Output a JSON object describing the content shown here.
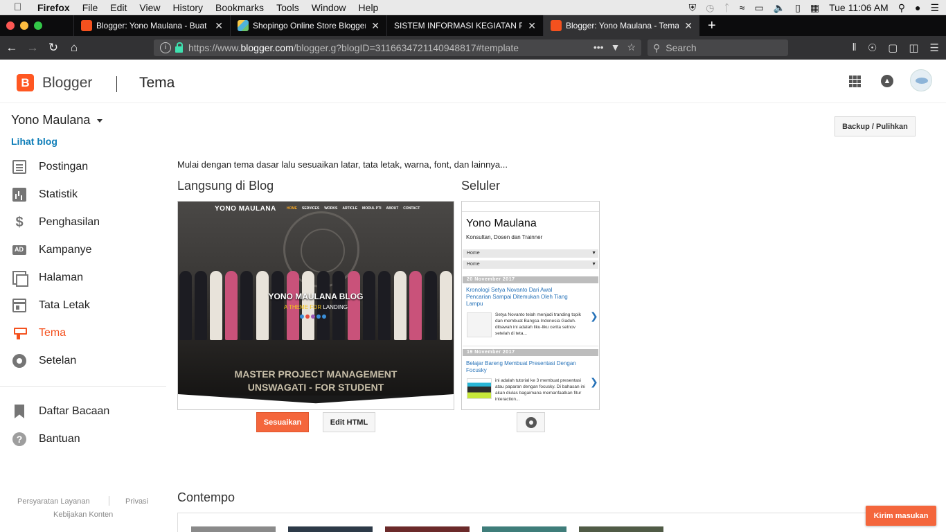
{
  "menubar": {
    "app": "Firefox",
    "items": [
      "File",
      "Edit",
      "View",
      "History",
      "Bookmarks",
      "Tools",
      "Window",
      "Help"
    ],
    "clock": "Tue 11:06 AM"
  },
  "tabs": [
    {
      "title": "Blogger: Yono Maulana - Buat e",
      "favicon_color": "#f4511e"
    },
    {
      "title": "Shopingo Online Store Blogger",
      "favicon_color": "#4fb3d9"
    },
    {
      "title": "SISTEM INFORMASI KEGIATAN POL",
      "favicon_color": ""
    },
    {
      "title": "Blogger: Yono Maulana - Tema",
      "favicon_color": "#f4511e"
    }
  ],
  "navbar": {
    "url_prefix": "https://www.",
    "url_domain": "blogger.com",
    "url_rest": "/blogger.g?blogID=3116634721140948817#template",
    "search_placeholder": "Search"
  },
  "header": {
    "logo_letter": "B",
    "brand": "Blogger",
    "page": "Tema"
  },
  "sidebar": {
    "blog_title": "Yono Maulana",
    "view_blog": "Lihat blog",
    "items": [
      {
        "label": "Postingan"
      },
      {
        "label": "Statistik"
      },
      {
        "label": "Penghasilan"
      },
      {
        "label": "Kampanye"
      },
      {
        "label": "Halaman"
      },
      {
        "label": "Tata Letak"
      },
      {
        "label": "Tema"
      },
      {
        "label": "Setelan"
      }
    ],
    "items2": [
      {
        "label": "Daftar Bacaan"
      },
      {
        "label": "Bantuan"
      }
    ],
    "footer": {
      "terms": "Persyaratan Layanan",
      "privacy": "Privasi",
      "content_policy": "Kebijakan Konten"
    }
  },
  "main": {
    "backup_label": "Backup / Pulihkan",
    "intro": "Mulai dengan tema dasar lalu sesuaikan latar, tata letak, warna, font, dan lainnya...",
    "live_heading": "Langsung di Blog",
    "mobile_heading": "Seluler",
    "customize_label": "Sesuaikan",
    "edit_html_label": "Edit HTML",
    "contempo_heading": "Contempo",
    "feedback_label": "Kirim masukan"
  },
  "desktop_preview": {
    "logo": "YONO MAULANA",
    "menu": [
      "HOME",
      "SERVICES",
      "WORKS",
      "ARTICLE",
      "MODUL PTI",
      "ABOUT",
      "CONTACT"
    ],
    "blog_title": "YONO MAULANA BLOG",
    "subtitle_a": "A THEME FOR",
    "subtitle_b": "LANDING",
    "master_line1": "MASTER PROJECT MANAGEMENT",
    "master_line2": "UNSWAGATI - FOR STUDENT"
  },
  "mobile_preview": {
    "title": "Yono Maulana",
    "description": "Konsultan, Dosen dan Trainner",
    "select1": "Home",
    "select2": "Home",
    "date1": "20 November 2017",
    "post1_title": "Kronologi Setya Novanto Dari Awal Pencarian Sampai Ditemukan Oleh Tiang Lampu",
    "post1_snippet": "Setya Novanto telah menjadi tranding topik dan membuat Bangsa Indonesia Gaduh. dibawah ini adalah liku-liku cerita setnov setelah di teta...",
    "date2": "19 November 2017",
    "post2_title": "Belajar Bareng Membuat Presentasi Dengan Focusky",
    "post2_snippet": "ini adalah tutorial ke 3 membuat presentasi atau paparan dengan focusky. Di bahasan ini akan diulas bagaimana memanfaatkan fitur interaction..."
  },
  "colors": {
    "accent": "#f4511e",
    "link": "#0d7db8",
    "button_primary": "#f4663c"
  }
}
